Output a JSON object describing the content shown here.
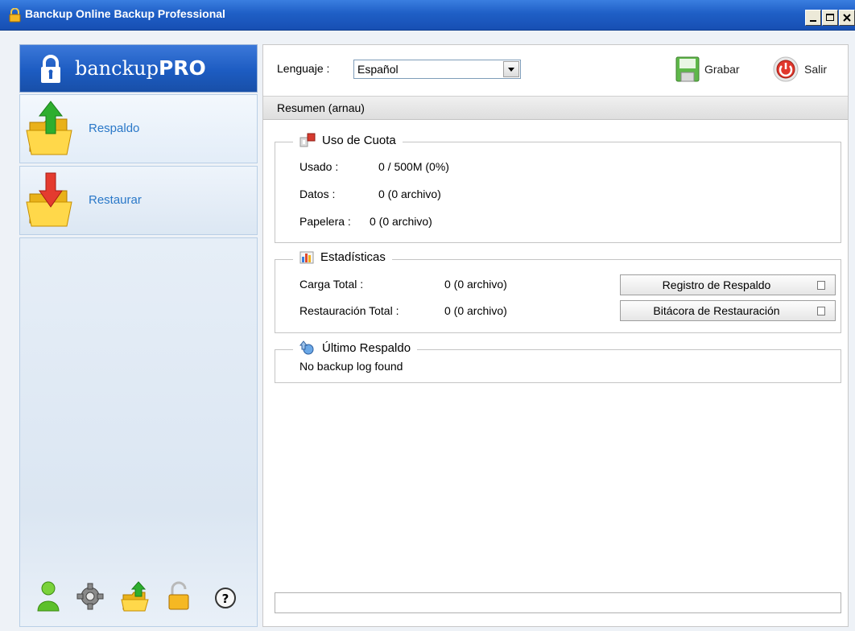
{
  "window": {
    "title": "Banckup Online Backup Professional",
    "title_bar_color": "#1f5fc6"
  },
  "sidebar": {
    "logo": {
      "brand_light": "banckup",
      "brand_bold": "PRO"
    },
    "items": [
      {
        "label": "Respaldo",
        "icon": "backup-folder-icon"
      },
      {
        "label": "Restaurar",
        "icon": "restore-folder-icon"
      }
    ],
    "bottom_icons": [
      "user-icon",
      "gear-icon",
      "upload-folder-icon",
      "lock-icon",
      "help-icon"
    ],
    "accent_color": "#2a78c8"
  },
  "toolbar": {
    "language_label": "Lenguaje :",
    "language_value": "Español",
    "save_label": "Grabar",
    "exit_label": "Salir"
  },
  "summary": {
    "header": "Resumen (arnau)",
    "quota": {
      "title": "Uso de Cuota",
      "rows": [
        {
          "label": "Usado :",
          "value": "0 / 500M (0%)"
        },
        {
          "label": "Datos :",
          "value": "0  (0 archivo)"
        },
        {
          "label": "Papelera :",
          "value": "0  (0 archivo)"
        }
      ]
    },
    "stats": {
      "title": "Estadísticas",
      "rows": [
        {
          "label": "Carga Total :",
          "value": "0  (0 archivo)"
        },
        {
          "label": "Restauración Total :",
          "value": "0  (0 archivo)"
        }
      ],
      "backup_log_button": "Registro de Respaldo",
      "restore_log_button": "Bitácora de Restauración"
    },
    "last_backup": {
      "title": "Último Respaldo",
      "message": "No backup log found"
    }
  }
}
